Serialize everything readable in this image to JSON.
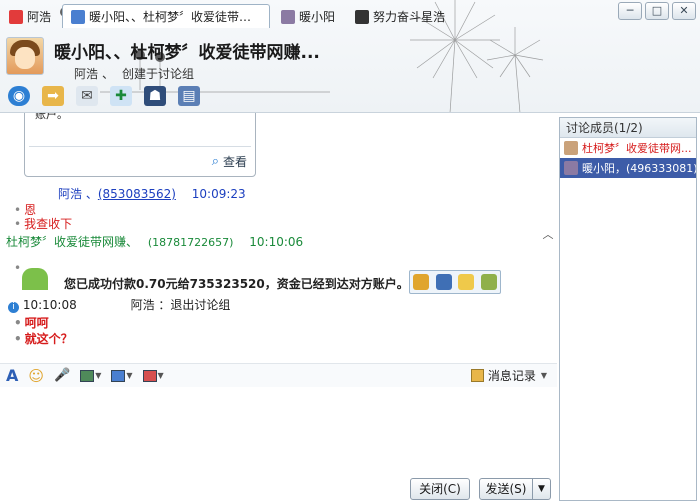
{
  "tabs": [
    {
      "label": "阿浩",
      "icon": "qq-penguin-icon",
      "active": false
    },
    {
      "label": "暖小阳、、杜柯梦〞收爱徒带网赚...",
      "icon": "discussion-group-icon",
      "active": true
    },
    {
      "label": "暖小阳",
      "icon": "user-avatar-icon",
      "active": false
    },
    {
      "label": "努力奋斗星浩",
      "icon": "user-avatar-icon",
      "active": false
    }
  ],
  "window_controls": {
    "minimize": "─",
    "maximize": "□",
    "close": "✕"
  },
  "header": {
    "title": "暖小阳、、杜柯梦〞收爱徒带网赚...",
    "creator": "阿浩",
    "creator_sep": "、",
    "created_label": "创建于讨论组"
  },
  "toolbar_icons": [
    "video-call-icon",
    "file-transfer-icon",
    "mail-icon",
    "add-member-icon",
    "service-icon",
    "apps-icon"
  ],
  "card": {
    "text": "账户。",
    "check_label": "查看"
  },
  "messages": {
    "m1_name": "阿浩",
    "m1_sep": "、",
    "m1_id": "(853083562)",
    "m1_time": "10:09:23",
    "m1_lines": [
      "恩",
      "我查收下"
    ],
    "m2_name": "杜柯梦〞收爱徒带网赚、",
    "m2_id": "(18781722657)",
    "m2_time": "10:10:06",
    "pay_text": "您已成功付款0.70元给735323520，资金已经到达对方账户。",
    "sys_time": "10:10:08",
    "sys_text": "阿浩 ：退出讨论组",
    "m3_lines": [
      "呵呵",
      "就这个？"
    ]
  },
  "input_toolbar": {
    "icons": [
      "font-icon",
      "emoji-icon",
      "voice-icon",
      "image-icon",
      "screenshot-icon",
      "gift-icon"
    ],
    "history_label": "消息记录"
  },
  "members": {
    "header": "讨论成员(1/2)",
    "items": [
      {
        "name": "杜柯梦〞收爱徒带网...",
        "color": "#d61c1c",
        "selected": false
      },
      {
        "name": "暖小阳，(496333081)",
        "color": "#ffffff",
        "selected": true
      }
    ]
  },
  "buttons": {
    "close": "关闭(C)",
    "send": "发送(S)",
    "send_dropdown": "▼"
  },
  "colors": {
    "accent": "#3d5ca8",
    "link_blue": "#1c3fbf",
    "green_name": "#1a8a3a",
    "red_text": "#d61c1c"
  }
}
